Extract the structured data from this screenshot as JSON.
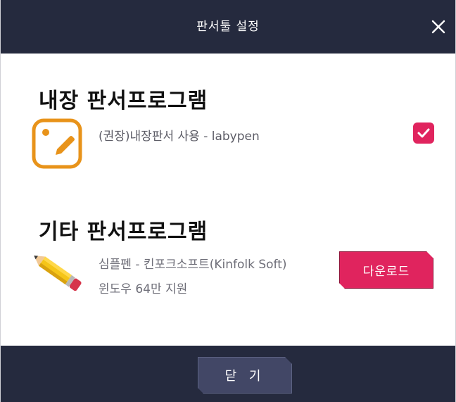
{
  "dialog": {
    "title": "판서툴 설정",
    "close_icon": "close-icon"
  },
  "builtin": {
    "heading": "내장 판서프로그램",
    "icon": "edit-pen-icon",
    "option_label": "(권장)내장판서 사용 - labypen",
    "checked": true
  },
  "other": {
    "heading": "기타 판서프로그램",
    "icon": "pencil-icon",
    "program_name": "심플펜 - 킨포크소프트(Kinfolk Soft)",
    "program_desc": "윈도우 64만 지원",
    "download_label": "다운로드"
  },
  "footer": {
    "close_label": "닫 기"
  },
  "colors": {
    "header_bg": "#252a3e",
    "accent": "#e0245e",
    "icon_orange": "#e8931a"
  }
}
